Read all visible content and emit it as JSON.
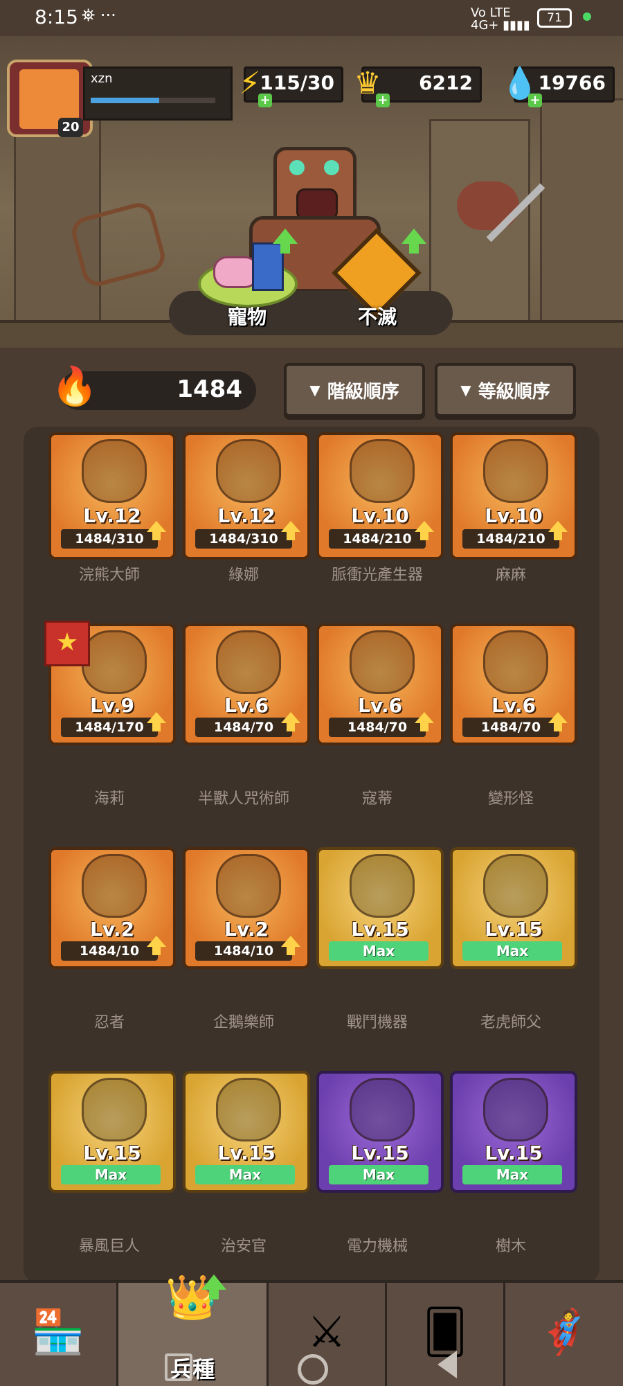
{
  "status_bar": {
    "time": "8:15",
    "icons": "⛯ ···",
    "network": "4G+",
    "network_sub": "Vo LTE",
    "battery": "71"
  },
  "player": {
    "name": "xzn",
    "level": "20",
    "xp_progress": 0.55
  },
  "resources": {
    "energy": "115/30",
    "gold": "6212",
    "gems": "19766"
  },
  "pets": [
    {
      "label": "寵物",
      "icon": "axolotl-pet-icon"
    },
    {
      "label": "不滅",
      "icon": "immortal-gem-icon"
    }
  ],
  "power": {
    "value": "1484"
  },
  "sort": {
    "rank": "階級順序",
    "level": "等級順序"
  },
  "colors": {
    "orange_card": "#e07a2a",
    "gold_card": "#d9a432",
    "purple_card": "#6c3fae",
    "max_green": "#4fd37a",
    "upgrade_green": "#67d84d"
  },
  "units": [
    {
      "name": "浣熊大師",
      "level": "Lv.12",
      "progress": "1484/310",
      "rarity": "orange",
      "upgradable": true
    },
    {
      "name": "綠娜",
      "level": "Lv.12",
      "progress": "1484/310",
      "rarity": "orange",
      "upgradable": true
    },
    {
      "name": "脈衝光產生器",
      "level": "Lv.10",
      "progress": "1484/210",
      "rarity": "orange",
      "upgradable": true
    },
    {
      "name": "麻麻",
      "level": "Lv.10",
      "progress": "1484/210",
      "rarity": "orange",
      "upgradable": true
    },
    {
      "name": "海莉",
      "level": "Lv.9",
      "progress": "1484/170",
      "rarity": "orange",
      "upgradable": true,
      "starred": true
    },
    {
      "name": "半獸人咒術師",
      "level": "Lv.6",
      "progress": "1484/70",
      "rarity": "orange",
      "upgradable": true
    },
    {
      "name": "寇蒂",
      "level": "Lv.6",
      "progress": "1484/70",
      "rarity": "orange",
      "upgradable": true
    },
    {
      "name": "變形怪",
      "level": "Lv.6",
      "progress": "1484/70",
      "rarity": "orange",
      "upgradable": true
    },
    {
      "name": "忍者",
      "level": "Lv.2",
      "progress": "1484/10",
      "rarity": "orange",
      "upgradable": true
    },
    {
      "name": "企鵝樂師",
      "level": "Lv.2",
      "progress": "1484/10",
      "rarity": "orange",
      "upgradable": true
    },
    {
      "name": "戰鬥機器",
      "level": "Lv.15",
      "progress": "Max",
      "rarity": "gold",
      "upgradable": false
    },
    {
      "name": "老虎師父",
      "level": "Lv.15",
      "progress": "Max",
      "rarity": "gold",
      "upgradable": false
    },
    {
      "name": "暴風巨人",
      "level": "Lv.15",
      "progress": "Max",
      "rarity": "gold",
      "upgradable": false
    },
    {
      "name": "治安官",
      "level": "Lv.15",
      "progress": "Max",
      "rarity": "gold",
      "upgradable": false
    },
    {
      "name": "電力機械",
      "level": "Lv.15",
      "progress": "Max",
      "rarity": "purple",
      "upgradable": false
    },
    {
      "name": "樹木",
      "level": "Lv.15",
      "progress": "Max",
      "rarity": "purple",
      "upgradable": false
    }
  ],
  "nav": [
    {
      "label": "",
      "icon": "shop-icon"
    },
    {
      "label": "兵種",
      "icon": "crown-icon"
    },
    {
      "label": "",
      "icon": "crossed-swords-icon"
    },
    {
      "label": "",
      "icon": "card-icon"
    },
    {
      "label": "",
      "icon": "heroes-icon"
    }
  ]
}
